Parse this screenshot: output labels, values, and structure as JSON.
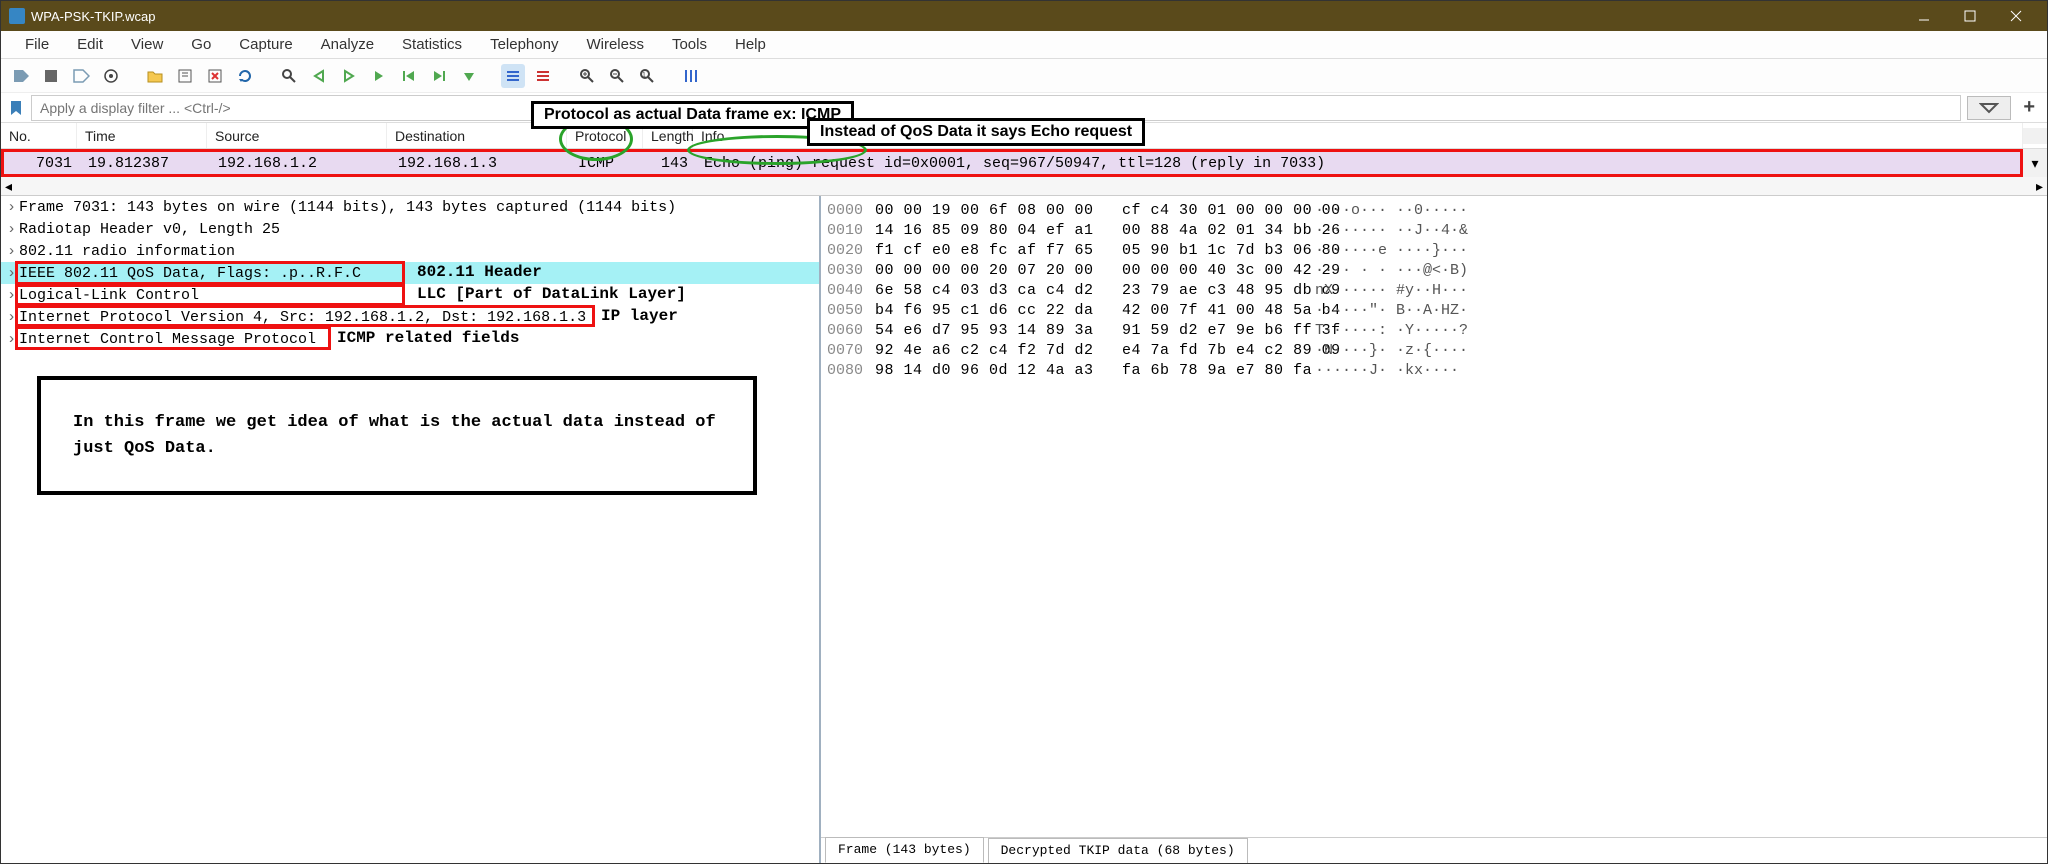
{
  "window": {
    "title": "WPA-PSK-TKIP.wcap"
  },
  "menu": {
    "items": [
      "File",
      "Edit",
      "View",
      "Go",
      "Capture",
      "Analyze",
      "Statistics",
      "Telephony",
      "Wireless",
      "Tools",
      "Help"
    ]
  },
  "filter": {
    "placeholder": "Apply a display filter ... <Ctrl-/>"
  },
  "columns": {
    "no": "No.",
    "time": "Time",
    "source": "Source",
    "destination": "Destination",
    "protocol": "Protocol",
    "length": "Length",
    "info": "Info"
  },
  "packet": {
    "no": "7031",
    "time": "19.812387",
    "src": "192.168.1.2",
    "dst": "192.168.1.3",
    "proto": "ICMP",
    "len": "143",
    "info": "Echo (ping) request  id=0x0001, seq=967/50947, ttl=128 (reply in 7033)"
  },
  "annotations": {
    "top1": "Protocol as actual Data frame ex: ICMP",
    "top2": "Instead of QoS Data it says Echo request",
    "label1": "802.11 Header",
    "label2": "LLC [Part of DataLink Layer]",
    "label3": "IP layer",
    "label4": "ICMP related fields",
    "note": "In this frame we get idea of what is the actual data instead of just QoS Data."
  },
  "tree": [
    "Frame 7031: 143 bytes on wire (1144 bits), 143 bytes captured (1144 bits)",
    "Radiotap Header v0, Length 25",
    "802.11 radio information",
    "IEEE 802.11 QoS Data, Flags: .p..R.F.C",
    "Logical-Link Control",
    "Internet Protocol Version 4, Src: 192.168.1.2, Dst: 192.168.1.3",
    "Internet Control Message Protocol"
  ],
  "hex": [
    {
      "off": "0000",
      "b": "00 00 19 00 6f 08 00 00   cf c4 30 01 00 00 00 00",
      "a": "····o··· ··0·····"
    },
    {
      "off": "0010",
      "b": "14 16 85 09 80 04 ef a1   00 88 4a 02 01 34 bb 26",
      "a": "········ ··J··4·&"
    },
    {
      "off": "0020",
      "b": "f1 cf e0 e8 fc af f7 65   05 90 b1 1c 7d b3 06 80",
      "a": "·······e ····}···"
    },
    {
      "off": "0030",
      "b": "00 00 00 00 20 07 20 00   00 00 00 40 3c 00 42 29",
      "a": "···· · · ···@<·B)"
    },
    {
      "off": "0040",
      "b": "6e 58 c4 03 d3 ca c4 d2   23 79 ae c3 48 95 db c9",
      "a": "nX······ #y··H···"
    },
    {
      "off": "0050",
      "b": "b4 f6 95 c1 d6 cc 22 da   42 00 7f 41 00 48 5a b4",
      "a": "······\"· B··A·HZ·"
    },
    {
      "off": "0060",
      "b": "54 e6 d7 95 93 14 89 3a   91 59 d2 e7 9e b6 ff 3f",
      "a": "T······: ·Y·····?"
    },
    {
      "off": "0070",
      "b": "92 4e a6 c2 c4 f2 7d d2   e4 7a fd 7b e4 c2 89 09",
      "a": "·N····}· ·z·{····"
    },
    {
      "off": "0080",
      "b": "98 14 d0 96 0d 12 4a a3   fa 6b 78 9a e7 80 fa",
      "a": "······J· ·kx····"
    }
  ],
  "tabs": {
    "frame": "Frame (143 bytes)",
    "decrypted": "Decrypted TKIP data (68 bytes)"
  }
}
